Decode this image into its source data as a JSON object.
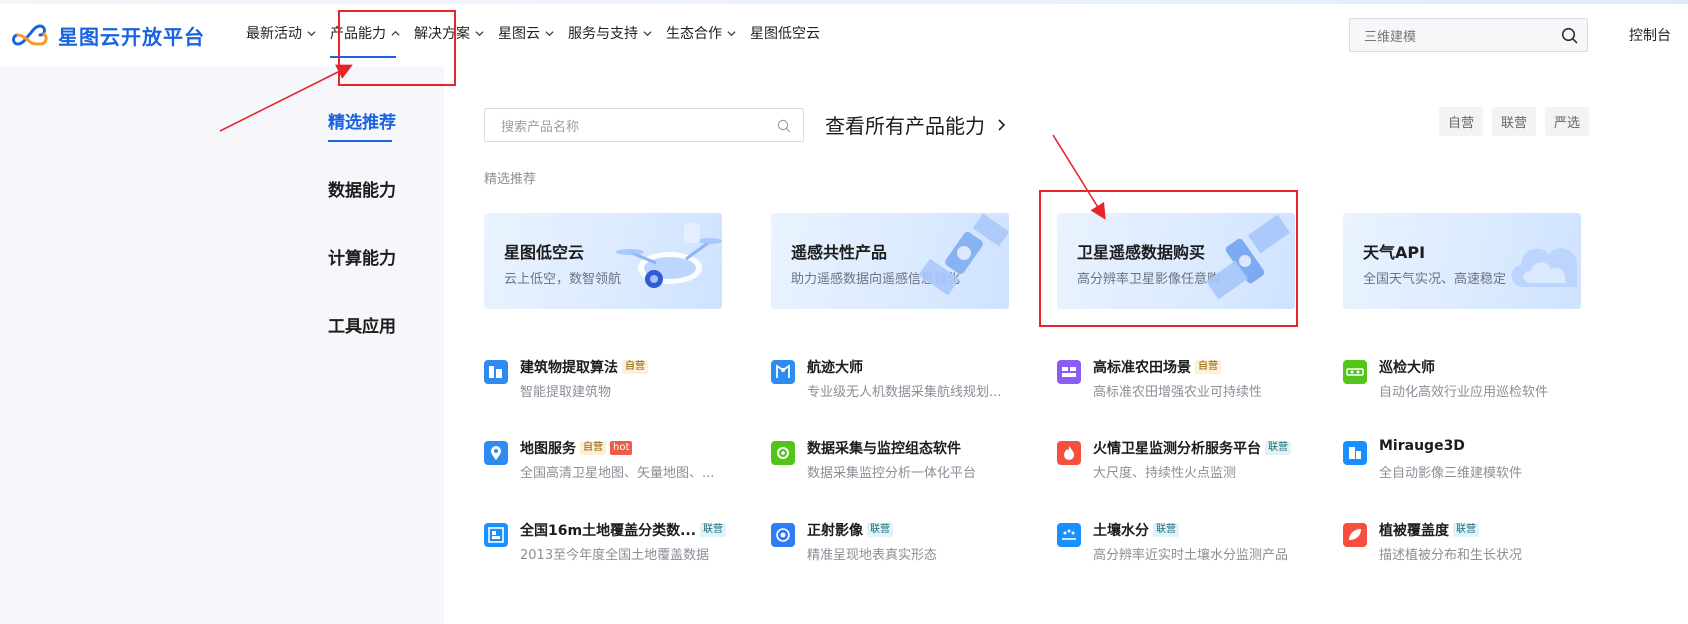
{
  "header": {
    "logo_text": "星图云开放平台",
    "nav": [
      {
        "label": "最新活动",
        "has_chevron": true,
        "chevron": "chevron-down-icon"
      },
      {
        "label": "产品能力",
        "has_chevron": true,
        "chevron": "chevron-up-icon",
        "active": true
      },
      {
        "label": "解决方案",
        "has_chevron": true,
        "chevron": "chevron-down-icon"
      },
      {
        "label": "星图云",
        "has_chevron": true,
        "chevron": "chevron-down-icon"
      },
      {
        "label": "服务与支持",
        "has_chevron": true,
        "chevron": "chevron-down-icon"
      },
      {
        "label": "生态合作",
        "has_chevron": true,
        "chevron": "chevron-down-icon"
      },
      {
        "label": "星图低空云",
        "has_chevron": false
      }
    ],
    "search_placeholder": "三维建模",
    "console_label": "控制台"
  },
  "panel": {
    "side_menu": [
      {
        "label": "精选推荐",
        "active": true
      },
      {
        "label": "数据能力"
      },
      {
        "label": "计算能力"
      },
      {
        "label": "工具应用"
      }
    ],
    "search_placeholder": "搜索产品名称",
    "view_all_label": "查看所有产品能力",
    "filters": [
      "自营",
      "联营",
      "严选"
    ],
    "section_label": "精选推荐",
    "cards": [
      {
        "title": "星图低空云",
        "desc": "云上低空，数智领航",
        "art": "drone-illustration"
      },
      {
        "title": "遥感共性产品",
        "desc": "助力遥感数据向遥感信息转化",
        "art": "satellite-illustration"
      },
      {
        "title": "卫星遥感数据购买",
        "desc": "高分辨率卫星影像任意购",
        "art": "satellite-illustration"
      },
      {
        "title": "天气API",
        "desc": "全国天气实况、高速稳定",
        "art": "cloud-illustration"
      }
    ],
    "products": [
      {
        "name": "建筑物提取算法",
        "desc": "智能提取建筑物",
        "badges": [
          {
            "text": "自营",
            "type": "self"
          }
        ],
        "icon": "building-icon",
        "icon_color": "#2e8cf0"
      },
      {
        "name": "航迹大师",
        "desc": "专业级无人机数据采集航线规划...",
        "badges": [],
        "icon": "route-map-icon",
        "icon_color": "#2e8cf0"
      },
      {
        "name": "高标准农田场景",
        "desc": "高标准农田增强农业可持续性",
        "badges": [
          {
            "text": "自营",
            "type": "self"
          }
        ],
        "icon": "farmland-icon",
        "icon_color": "#8b5cf6"
      },
      {
        "name": "巡检大师",
        "desc": "自动化高效行业应用巡检软件",
        "badges": [],
        "icon": "inspection-icon",
        "icon_color": "#52c41a"
      },
      {
        "name": "地图服务",
        "desc": "全国高清卫星地图、矢量地图、...",
        "badges": [
          {
            "text": "自营",
            "type": "self"
          },
          {
            "text": "hot",
            "type": "hot"
          }
        ],
        "icon": "location-pin-icon",
        "icon_color": "#2e8cf0"
      },
      {
        "name": "数据采集与监控组态软件",
        "desc": "数据采集监控分析一体化平台",
        "badges": [],
        "icon": "monitor-gear-icon",
        "icon_color": "#52c41a"
      },
      {
        "name": "火情卫星监测分析服务平台",
        "desc": "大尺度、持续性火点监测",
        "badges": [
          {
            "text": "联营",
            "type": "joint"
          }
        ],
        "icon": "fire-icon",
        "icon_color": "#f5503d"
      },
      {
        "name": "Mirauge3D",
        "desc": "全自动影像三维建模软件",
        "badges": [],
        "icon": "building-3d-icon",
        "icon_color": "#1890ff"
      },
      {
        "name": "全国16m土地覆盖分类数...",
        "desc": "2013至今年度全国土地覆盖数据",
        "badges": [
          {
            "text": "联营",
            "type": "joint"
          }
        ],
        "icon": "land-cover-icon",
        "icon_color": "#1890ff"
      },
      {
        "name": "正射影像",
        "desc": "精准呈现地表真实形态",
        "badges": [
          {
            "text": "联营",
            "type": "joint"
          }
        ],
        "icon": "ortho-image-icon",
        "icon_color": "#2e7cf6"
      },
      {
        "name": "土壤水分",
        "desc": "高分辨率近实时土壤水分监测产品",
        "badges": [
          {
            "text": "联营",
            "type": "joint"
          }
        ],
        "icon": "soil-moisture-icon",
        "icon_color": "#1890ff"
      },
      {
        "name": "植被覆盖度",
        "desc": "描述植被分布和生长状况",
        "badges": [
          {
            "text": "联营",
            "type": "joint"
          }
        ],
        "icon": "vegetation-icon",
        "icon_color": "#f5503d"
      }
    ]
  },
  "colors": {
    "brand": "#1a63e0",
    "annotation": "#e8242b"
  }
}
